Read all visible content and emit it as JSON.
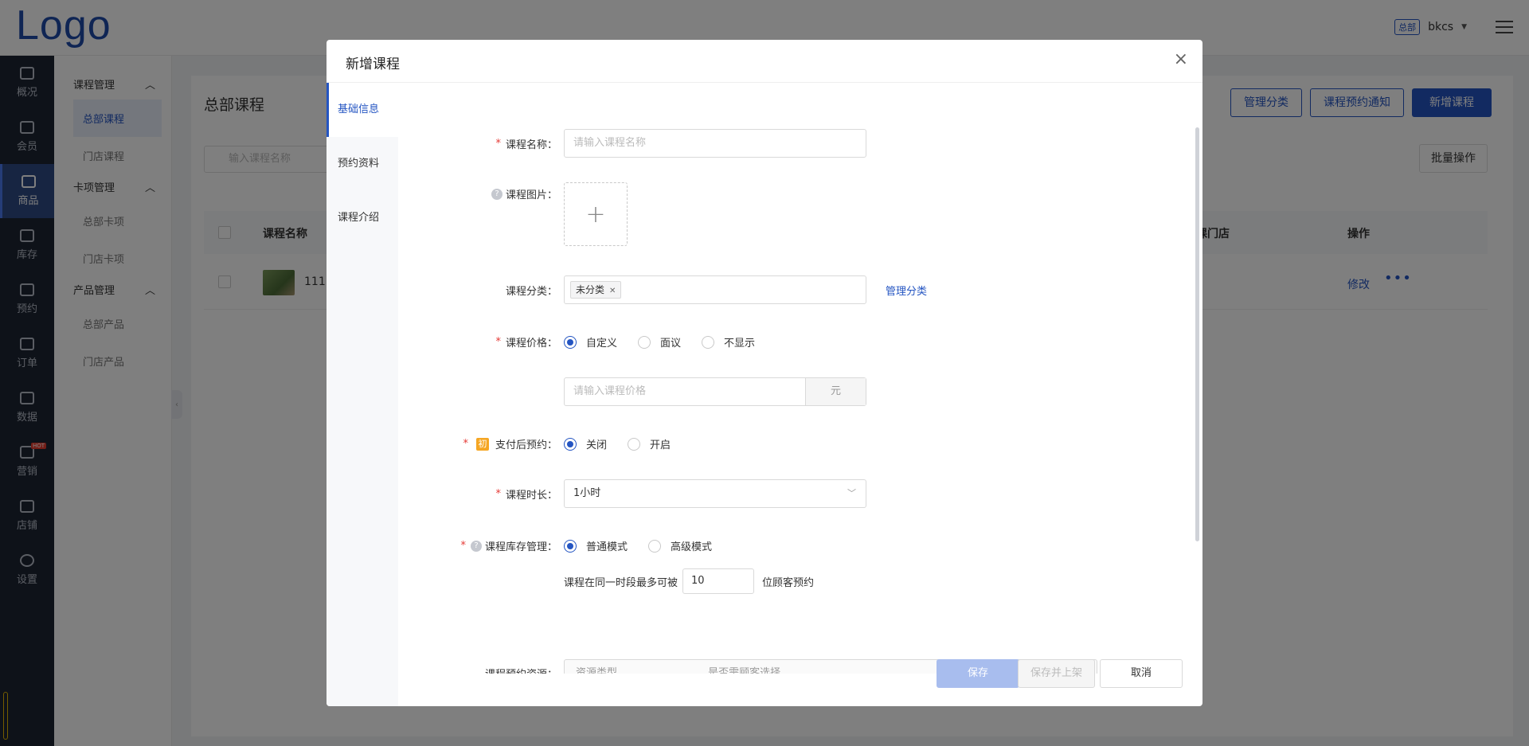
{
  "app": {
    "logo": "Logo",
    "hq_badge": "总部",
    "user": "bkcs"
  },
  "nav": {
    "items": [
      {
        "label": "概况"
      },
      {
        "label": "会员"
      },
      {
        "label": "商品"
      },
      {
        "label": "库存"
      },
      {
        "label": "预约"
      },
      {
        "label": "订单"
      },
      {
        "label": "数据"
      },
      {
        "label": "营销",
        "badge": "HOT"
      },
      {
        "label": "店铺"
      },
      {
        "label": "设置"
      }
    ]
  },
  "subnav": {
    "groups": [
      {
        "title": "课程管理",
        "items": [
          "总部课程",
          "门店课程"
        ]
      },
      {
        "title": "卡项管理",
        "items": [
          "总部卡项",
          "门店卡项"
        ]
      },
      {
        "title": "产品管理",
        "items": [
          "总部产品",
          "门店产品"
        ]
      }
    ]
  },
  "page": {
    "title": "总部课程",
    "btn_manage_category": "管理分类",
    "btn_notice": "课程预约通知",
    "btn_new": "新增课程",
    "search_placeholder": "输入课程名称",
    "batch": "批量操作",
    "col_name": "课程名称",
    "col_store": "课门店",
    "col_ops": "操作",
    "row_name": "1111",
    "row_edit": "修改",
    "row_more": "•••"
  },
  "modal": {
    "title": "新增课程",
    "tabs": [
      "基础信息",
      "预约资料",
      "课程介绍"
    ],
    "form": {
      "name_label": "课程名称：",
      "name_placeholder": "请输入课程名称",
      "image_label": "课程图片：",
      "category_label": "课程分类：",
      "category_tag": "未分类",
      "manage_category": "管理分类",
      "price_label": "课程价格：",
      "price_options": [
        "自定义",
        "面议",
        "不显示"
      ],
      "price_placeholder": "请输入课程价格",
      "price_unit": "元",
      "pay_label": "支付后预约：",
      "pay_badge": "初",
      "pay_options": [
        "关闭",
        "开启"
      ],
      "duration_label": "课程时长：",
      "duration_value": "1小时",
      "stock_label": "课程库存管理：",
      "stock_options": [
        "普通模式",
        "高级模式"
      ],
      "capacity_prefix": "课程在同一时段最多可被",
      "capacity_value": "10",
      "capacity_suffix": "位顾客预约",
      "resource_label": "课程预约资源：",
      "resource_col1": "资源类型",
      "resource_col2": "是否需顾客选择"
    },
    "footer": {
      "save": "保存",
      "save_publish": "保存并上架",
      "cancel": "取消"
    }
  },
  "colors": {
    "primary": "#2455c2",
    "nav_bg": "#1d2433",
    "required": "#e53935"
  }
}
